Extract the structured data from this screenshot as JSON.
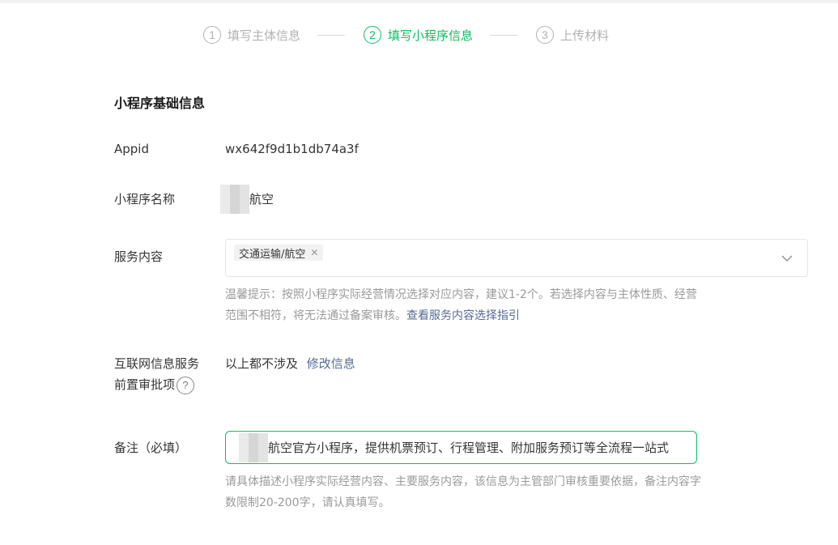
{
  "steps": [
    {
      "num": "1",
      "label": "填写主体信息",
      "active": false
    },
    {
      "num": "2",
      "label": "填写小程序信息",
      "active": true
    },
    {
      "num": "3",
      "label": "上传材料",
      "active": false
    }
  ],
  "section": {
    "title": "小程序基础信息"
  },
  "appid": {
    "label": "Appid",
    "value": "wx642f9d1b1db74a3f"
  },
  "name": {
    "label": "小程序名称",
    "value_suffix": "航空"
  },
  "service": {
    "label": "服务内容",
    "tag": "交通运输/航空",
    "hint_text": "温馨提示：按照小程序实际经营情况选择对应内容，建议1-2个。若选择内容与主体性质、经营范围不相符，将无法通过备案审核。",
    "hint_link": "查看服务内容选择指引"
  },
  "approval": {
    "label_line1": "互联网信息服务",
    "label_line2": "前置审批项",
    "help_icon": "?",
    "value": "以上都不涉及",
    "edit_link": "修改信息"
  },
  "remark": {
    "label": "备注（必填）",
    "value_suffix": "航空官方小程序，提供机票预订、行程管理、附加服务预订等全流程一站式",
    "hint": "请具体描述小程序实际经营内容、主要服务内容，该信息为主管部门审核重要依据，备注内容字数限制20-200字，请认真填写。"
  },
  "colors": {
    "accent": "#07c160",
    "link": "#576b95",
    "muted": "#9a9a9a"
  }
}
